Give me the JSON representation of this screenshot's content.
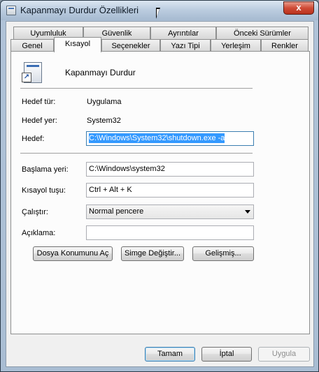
{
  "window": {
    "title": "Kapanmayı Durdur Özellikleri",
    "close_label": "x"
  },
  "tabs_row1": [
    {
      "label": "Uyumluluk"
    },
    {
      "label": "Güvenlik"
    },
    {
      "label": "Ayrıntılar"
    },
    {
      "label": "Önceki Sürümler"
    }
  ],
  "tabs_row2": [
    {
      "label": "Genel"
    },
    {
      "label": "Kısayol"
    },
    {
      "label": "Seçenekler"
    },
    {
      "label": "Yazı Tipi"
    },
    {
      "label": "Yerleşim"
    },
    {
      "label": "Renkler"
    }
  ],
  "active_tab": "Kısayol",
  "shortcut": {
    "name": "Kapanmayı Durdur",
    "target_type_label": "Hedef tür:",
    "target_type": "Uygulama",
    "target_location_label": "Hedef yer:",
    "target_location": "System32",
    "target_label": "Hedef:",
    "target_value": "C:\\Windows\\System32\\shutdown.exe -a",
    "start_in_label": "Başlama yeri:",
    "start_in_value": "C:\\Windows\\system32",
    "hotkey_label": "Kısayol tuşu:",
    "hotkey_value": "Ctrl + Alt + K",
    "run_label": "Çalıştır:",
    "run_value": "Normal pencere",
    "comment_label": "Açıklama:",
    "comment_value": ""
  },
  "actions": {
    "open_location": "Dosya Konumunu Aç",
    "change_icon": "Simge Değiştir...",
    "advanced": "Gelişmiş..."
  },
  "dialog_buttons": {
    "ok": "Tamam",
    "cancel": "İptal",
    "apply": "Uygula"
  }
}
